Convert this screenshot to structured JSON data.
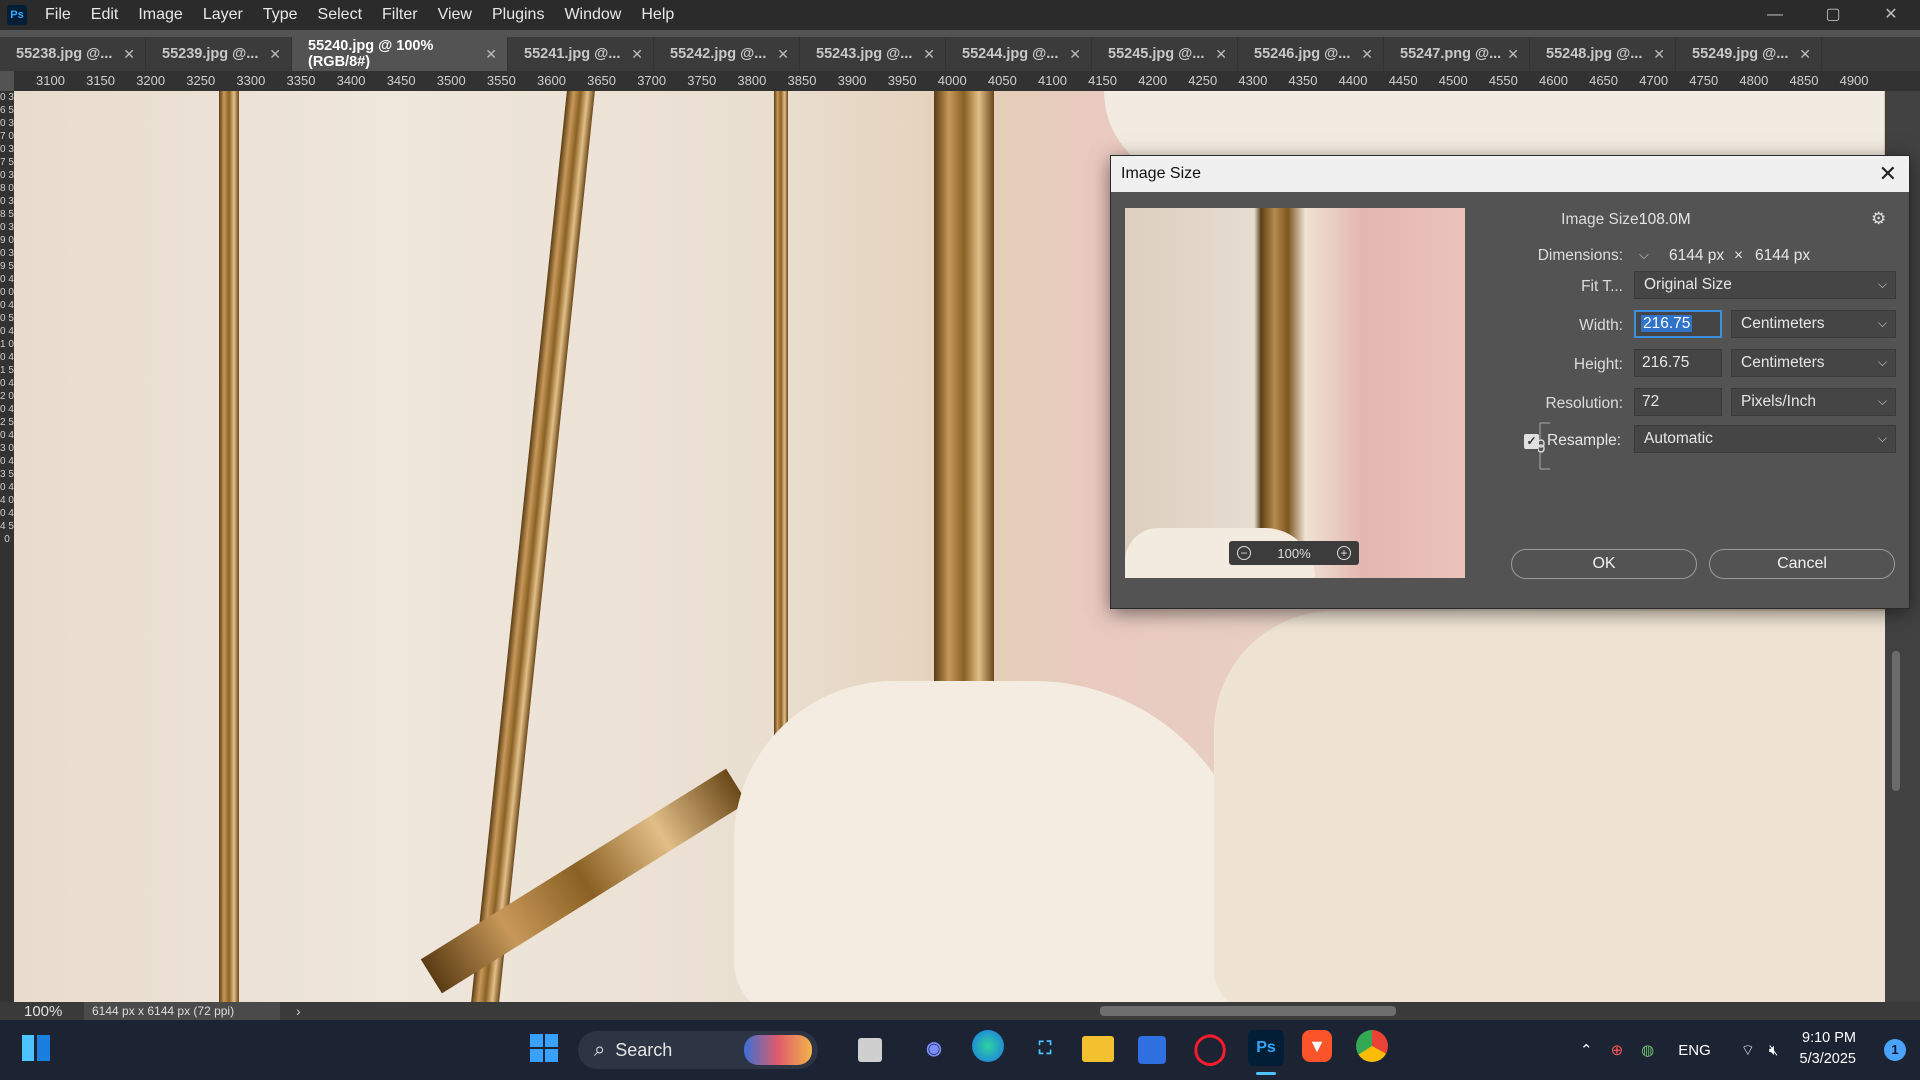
{
  "app": {
    "logo": "Ps",
    "menu": [
      "File",
      "Edit",
      "Image",
      "Layer",
      "Type",
      "Select",
      "Filter",
      "View",
      "Plugins",
      "Window",
      "Help"
    ]
  },
  "window_controls": {
    "minimize": "—",
    "maximize": "▢",
    "close": "✕"
  },
  "tabs": [
    {
      "label": "55238.jpg @..."
    },
    {
      "label": "55239.jpg @..."
    },
    {
      "label": "55240.jpg @ 100% (RGB/8#)"
    },
    {
      "label": "55241.jpg @..."
    },
    {
      "label": "55242.jpg @..."
    },
    {
      "label": "55243.jpg @..."
    },
    {
      "label": "55244.jpg @..."
    },
    {
      "label": "55245.jpg @..."
    },
    {
      "label": "55246.jpg @..."
    },
    {
      "label": "55247.png @..."
    },
    {
      "label": "55248.jpg @..."
    },
    {
      "label": "55249.jpg @..."
    }
  ],
  "ruler": {
    "horizontal": [
      "3100",
      "3150",
      "3200",
      "3250",
      "3300",
      "3350",
      "3400",
      "3450",
      "3500",
      "3550",
      "3600",
      "3650",
      "3700",
      "3750",
      "3800",
      "3850",
      "3900",
      "3950",
      "4000",
      "4050",
      "4100",
      "4150",
      "4200",
      "4250",
      "4300",
      "4350",
      "4400",
      "4450",
      "4500",
      "4550",
      "4600",
      "4650",
      "4700",
      "4750",
      "4800",
      "4850",
      "4900"
    ],
    "vertical": "0 3 6 5 0 3 7 0 0 3 7 5 0 3 8 0 0 3 8 5 0 3 9 0 0 3 9 5 0 4 0 0 0 4 0 5 0 4 1 0 0 4 1 5 0 4 2 0 0 4 2 5 0 4 3 0 0 4 3 5 0 4 4 0 0 4 4 5 0"
  },
  "status": {
    "zoom": "100%",
    "doc_info": "6144 px x 6144 px (72 ppi)",
    "arrow": "›"
  },
  "dialog": {
    "title": "Image Size",
    "image_size_label": "Image Size:",
    "image_size_value": "108.0M",
    "dimensions_label": "Dimensions:",
    "dimensions_width": "6144 px",
    "dimensions_x": "×",
    "dimensions_height": "6144 px",
    "fit_label": "Fit T...",
    "fit_value": "Original Size",
    "width_label": "Width:",
    "width_value": "216.75",
    "width_unit": "Centimeters",
    "height_label": "Height:",
    "height_value": "216.75",
    "height_unit": "Centimeters",
    "resolution_label": "Resolution:",
    "resolution_value": "72",
    "resolution_unit": "Pixels/Inch",
    "resample_label": "Resample:",
    "resample_checked": true,
    "resample_value": "Automatic",
    "preview_zoom": "100%",
    "ok_label": "OK",
    "cancel_label": "Cancel"
  },
  "taskbar": {
    "search_label": "Search",
    "tray_lang": "ENG",
    "time": "9:10 PM",
    "date": "5/3/2025",
    "notifications": "1"
  }
}
